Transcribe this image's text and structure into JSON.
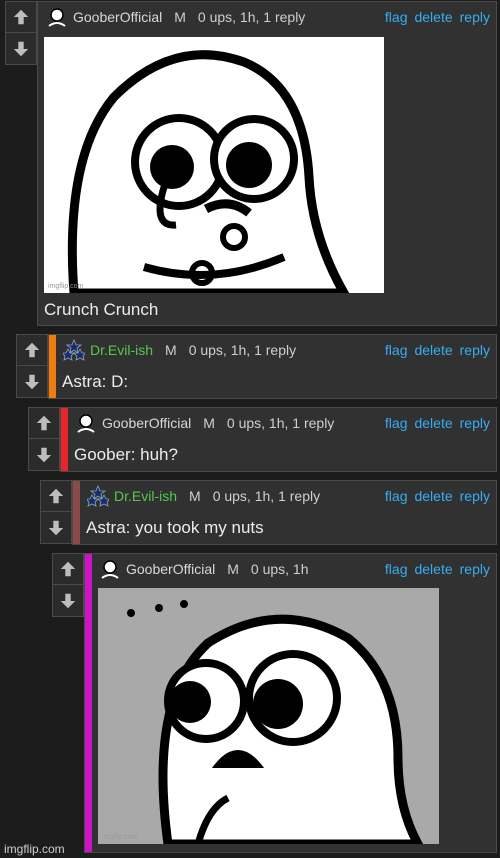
{
  "actions": {
    "flag": "flag",
    "delete": "delete",
    "reply": "reply"
  },
  "comments": [
    {
      "user": "GooberOfficial",
      "badge": "M",
      "meta": "0 ups, 1h, 1 reply",
      "text": "Crunch Crunch",
      "image_watermark": "imgflip.com",
      "stripe_color": ""
    },
    {
      "user": "Dr.Evil-ish",
      "badge": "M",
      "meta": "0 ups, 1h, 1 reply",
      "text": "Astra: D:",
      "stripe_color": "#f07d0b"
    },
    {
      "user": "GooberOfficial",
      "badge": "M",
      "meta": "0 ups, 1h, 1 reply",
      "text": "Goober: huh?",
      "stripe_color": "#e8262a"
    },
    {
      "user": "Dr.Evil-ish",
      "badge": "M",
      "meta": "0 ups, 1h, 1 reply",
      "text": "Astra: you took my nuts",
      "stripe_color": "#8a4a48"
    },
    {
      "user": "GooberOfficial",
      "badge": "M",
      "meta": "0 ups, 1h",
      "text": "",
      "image_watermark": "imgflip.com",
      "stripe_color": "#cc14c4"
    }
  ],
  "colors": {
    "link": "#35aef1",
    "username_green": "#57c84b",
    "background": "#1c1c1d",
    "card": "#313132"
  },
  "icons": {
    "upvote": "arrow-up-icon",
    "downvote": "arrow-down-icon",
    "goober_avatar": "goober-avatar-icon",
    "drevil_avatar": "stars-pyramid-avatar-icon"
  },
  "watermark": "imgflip.com"
}
